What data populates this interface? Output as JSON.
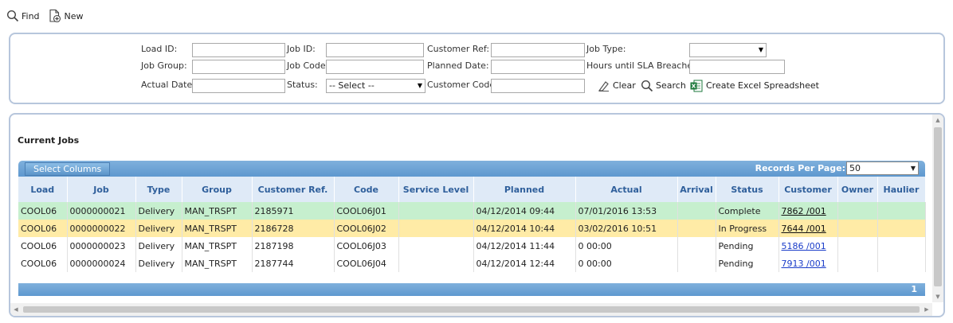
{
  "toolbar": {
    "find_label": "Find",
    "new_label": "New"
  },
  "search": {
    "load_id_label": "Load ID:",
    "job_id_label": "Job ID:",
    "customer_ref_label": "Customer Ref:",
    "job_type_label": "Job Type:",
    "job_type_value": "",
    "job_group_label": "Job Group:",
    "job_code_label": "Job Code",
    "planned_date_label": "Planned Date:",
    "hours_sla_label": "Hours until SLA Breached",
    "actual_date_label": "Actual Date:",
    "status_label": "Status:",
    "status_value": "-- Select --",
    "customer_code_label": "Customer Code",
    "clear_label": "Clear",
    "search_label": "Search",
    "excel_label": "Create Excel Spreadsheet"
  },
  "jobs": {
    "title": "Current Jobs",
    "select_columns_label": "Select Columns",
    "records_per_page_label": "Records Per Page:",
    "records_per_page_value": "50",
    "columns": [
      "Load",
      "Job",
      "Type",
      "Group",
      "Customer Ref.",
      "Code",
      "Service Level",
      "Planned",
      "Actual",
      "Arrival",
      "Status",
      "Customer",
      "Owner",
      "Haulier"
    ],
    "rows": [
      {
        "load": "COOL06",
        "job": "0000000021",
        "type": "Delivery",
        "group": "MAN_TRSPT",
        "customer_ref": "2185971",
        "code": "COOL06J01",
        "service_level": "",
        "planned": "04/12/2014 09:44",
        "actual": "07/01/2016 13:53",
        "arrival": "",
        "status": "Complete",
        "customer": "7862 /001",
        "owner": "",
        "haulier": ""
      },
      {
        "load": "COOL06",
        "job": "0000000022",
        "type": "Delivery",
        "group": "MAN_TRSPT",
        "customer_ref": "2186728",
        "code": "COOL06J02",
        "service_level": "",
        "planned": "04/12/2014 10:44",
        "actual": "03/02/2016 10:51",
        "arrival": "",
        "status": "In Progress",
        "customer": "7644 /001",
        "owner": "",
        "haulier": ""
      },
      {
        "load": "COOL06",
        "job": "0000000023",
        "type": "Delivery",
        "group": "MAN_TRSPT",
        "customer_ref": "2187198",
        "code": "COOL06J03",
        "service_level": "",
        "planned": "04/12/2014 11:44",
        "actual": "0 00:00",
        "arrival": "",
        "status": "Pending",
        "customer": "5186 /001",
        "owner": "",
        "haulier": ""
      },
      {
        "load": "COOL06",
        "job": "0000000024",
        "type": "Delivery",
        "group": "MAN_TRSPT",
        "customer_ref": "2187744",
        "code": "COOL06J04",
        "service_level": "",
        "planned": "04/12/2014 12:44",
        "actual": "0 00:00",
        "arrival": "",
        "status": "Pending",
        "customer": "7913 /001",
        "owner": "",
        "haulier": ""
      }
    ],
    "page_number": "1"
  },
  "colors": {
    "complete": "#c6efce",
    "in_progress": "#ffeba6",
    "header_blue": "#5e98cf",
    "link": "#1a3cc9"
  }
}
